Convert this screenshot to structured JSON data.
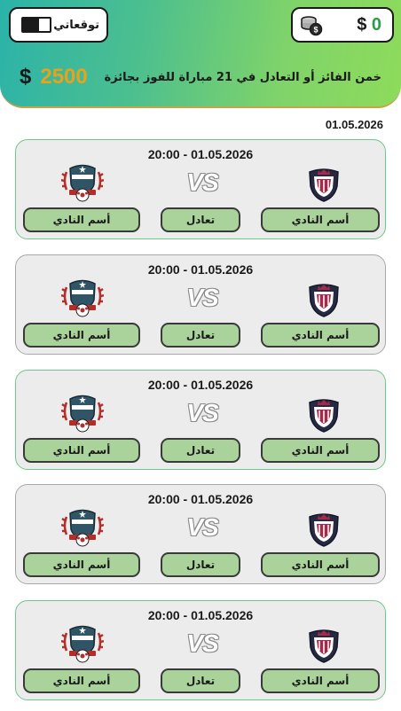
{
  "header": {
    "coins": {
      "currency": "$",
      "amount": "0",
      "icon": "coin-stack-icon"
    },
    "predictions": {
      "label": "توقعاتي",
      "progress": 0.6
    },
    "promo": {
      "text": "خمن الفائز أو التعادل في 21 مباراة  للفوز بجائزة",
      "prize_amount": "2500",
      "prize_currency": "$"
    }
  },
  "date_heading": "01.05.2026",
  "matches": [
    {
      "time": "20:00  -  01.05.2026",
      "vs": "VS",
      "home_label": "أسم النادي",
      "draw_label": "تعادل",
      "away_label": "أسم النادي",
      "home_badge": "home-crest-icon",
      "away_badge": "away-crest-icon"
    },
    {
      "time": "20:00  -  01.05.2026",
      "vs": "VS",
      "home_label": "أسم النادي",
      "draw_label": "تعادل",
      "away_label": "أسم النادي",
      "home_badge": "home-crest-icon",
      "away_badge": "away-crest-icon"
    },
    {
      "time": "20:00  -  01.05.2026",
      "vs": "VS",
      "home_label": "أسم النادي",
      "draw_label": "تعادل",
      "away_label": "أسم النادي",
      "home_badge": "home-crest-icon",
      "away_badge": "away-crest-icon"
    },
    {
      "time": "20:00  -  01.05.2026",
      "vs": "VS",
      "home_label": "أسم النادي",
      "draw_label": "تعادل",
      "away_label": "أسم النادي",
      "home_badge": "home-crest-icon",
      "away_badge": "away-crest-icon"
    },
    {
      "time": "20:00  -  01.05.2026",
      "vs": "VS",
      "home_label": "أسم النادي",
      "draw_label": "تعادل",
      "away_label": "أسم النادي",
      "home_badge": "home-crest-icon",
      "away_badge": "away-crest-icon"
    }
  ],
  "colors": {
    "header_gradient_start": "#2bb3a9",
    "header_gradient_end": "#8edb5b",
    "prize": "#e8a21c",
    "button_fill": "#a9d39a",
    "card_border_active": "#6cc987",
    "card_border_inactive": "#a8a8a8"
  }
}
